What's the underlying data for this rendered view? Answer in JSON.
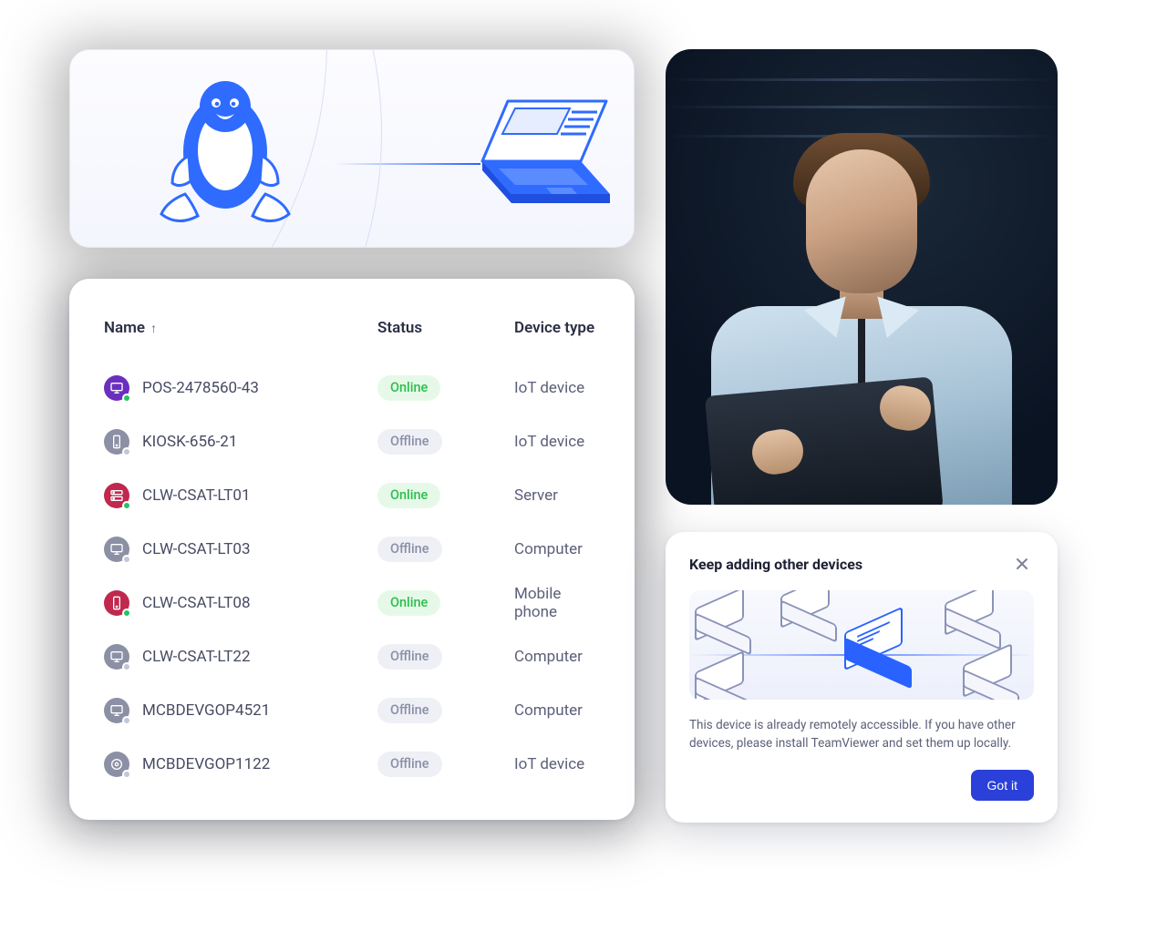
{
  "table": {
    "columns": {
      "name": "Name",
      "status": "Status",
      "type": "Device type"
    },
    "rows": [
      {
        "name": "POS-2478560-43",
        "status": "Online",
        "type": "IoT device",
        "icon": "monitor",
        "iconColor": "#6b2fbf",
        "badge": "green"
      },
      {
        "name": "KIOSK-656-21",
        "status": "Offline",
        "type": "IoT device",
        "icon": "mobile",
        "iconColor": "#8c90a5",
        "badge": "grey"
      },
      {
        "name": "CLW-CSAT-LT01",
        "status": "Online",
        "type": "Server",
        "icon": "server",
        "iconColor": "#c0284d",
        "badge": "green"
      },
      {
        "name": "CLW-CSAT-LT03",
        "status": "Offline",
        "type": "Computer",
        "icon": "monitor",
        "iconColor": "#8c90a5",
        "badge": "grey"
      },
      {
        "name": "CLW-CSAT-LT08",
        "status": "Online",
        "type": "Mobile phone",
        "icon": "mobile",
        "iconColor": "#c0284d",
        "badge": "green"
      },
      {
        "name": "CLW-CSAT-LT22",
        "status": "Offline",
        "type": "Computer",
        "icon": "monitor",
        "iconColor": "#8c90a5",
        "badge": "grey"
      },
      {
        "name": "MCBDEVGOP4521",
        "status": "Offline",
        "type": "Computer",
        "icon": "monitor",
        "iconColor": "#8c90a5",
        "badge": "grey"
      },
      {
        "name": "MCBDEVGOP1122",
        "status": "Offline",
        "type": "IoT device",
        "icon": "disc",
        "iconColor": "#8c90a5",
        "badge": "grey"
      }
    ]
  },
  "dialog": {
    "title": "Keep adding other devices",
    "body": "This device is already remotely accessible. If you have other devices, please install TeamViewer and set them up locally.",
    "confirm": "Got it"
  },
  "statusLabels": {
    "online": "Online",
    "offline": "Offline"
  }
}
